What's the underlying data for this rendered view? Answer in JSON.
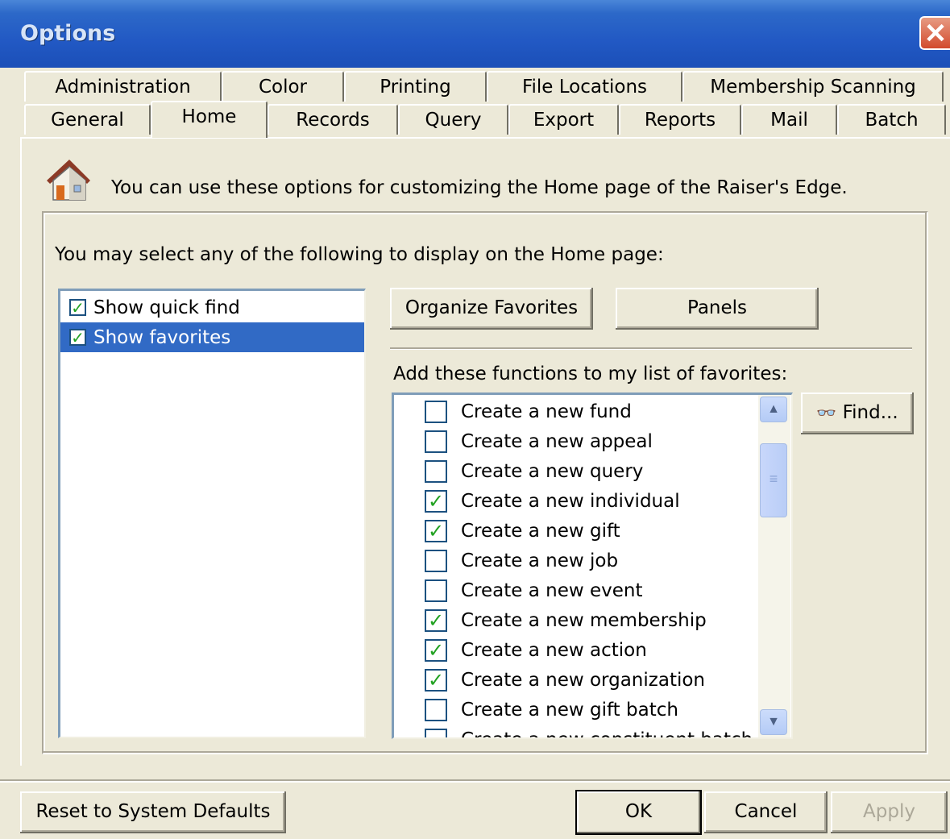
{
  "window": {
    "title": "Options",
    "close_glyph": "✕"
  },
  "tabs_back": [
    {
      "label": "Administration"
    },
    {
      "label": "Color"
    },
    {
      "label": "Printing"
    },
    {
      "label": "File Locations"
    },
    {
      "label": "Membership Scanning"
    }
  ],
  "tabs_front": [
    {
      "label": "General"
    },
    {
      "label": "Home"
    },
    {
      "label": "Records"
    },
    {
      "label": "Query"
    },
    {
      "label": "Export"
    },
    {
      "label": "Reports"
    },
    {
      "label": "Mail"
    },
    {
      "label": "Batch"
    }
  ],
  "active_tab": "Home",
  "home": {
    "description": "You can use these options for customizing the Home page of the Raiser's Edge.",
    "select_label": "You may select any of the following to display on the Home page:",
    "display_items": [
      {
        "label": "Show quick find",
        "checked": true,
        "selected": false
      },
      {
        "label": "Show favorites",
        "checked": true,
        "selected": true
      }
    ],
    "organize_favorites_label": "Organize Favorites",
    "panels_label": "Panels",
    "add_functions_label": "Add these functions to my list of favorites:",
    "find_label": "Find...",
    "functions": [
      {
        "label": "Create a new fund",
        "checked": false
      },
      {
        "label": "Create a new appeal",
        "checked": false
      },
      {
        "label": "Create a new query",
        "checked": false
      },
      {
        "label": "Create a new individual",
        "checked": true
      },
      {
        "label": "Create a new gift",
        "checked": true
      },
      {
        "label": "Create a new job",
        "checked": false
      },
      {
        "label": "Create a new event",
        "checked": false
      },
      {
        "label": "Create a new membership",
        "checked": true
      },
      {
        "label": "Create a new action",
        "checked": true
      },
      {
        "label": "Create a new organization",
        "checked": true
      },
      {
        "label": "Create a new gift batch",
        "checked": false
      },
      {
        "label": "Create a new constituent batch",
        "checked": false
      }
    ]
  },
  "footer": {
    "reset_label": "Reset to System Defaults",
    "ok_label": "OK",
    "cancel_label": "Cancel",
    "apply_label": "Apply"
  },
  "colors": {
    "titlebar": "#2259c4",
    "selection": "#316ac5",
    "check": "#21a121"
  }
}
